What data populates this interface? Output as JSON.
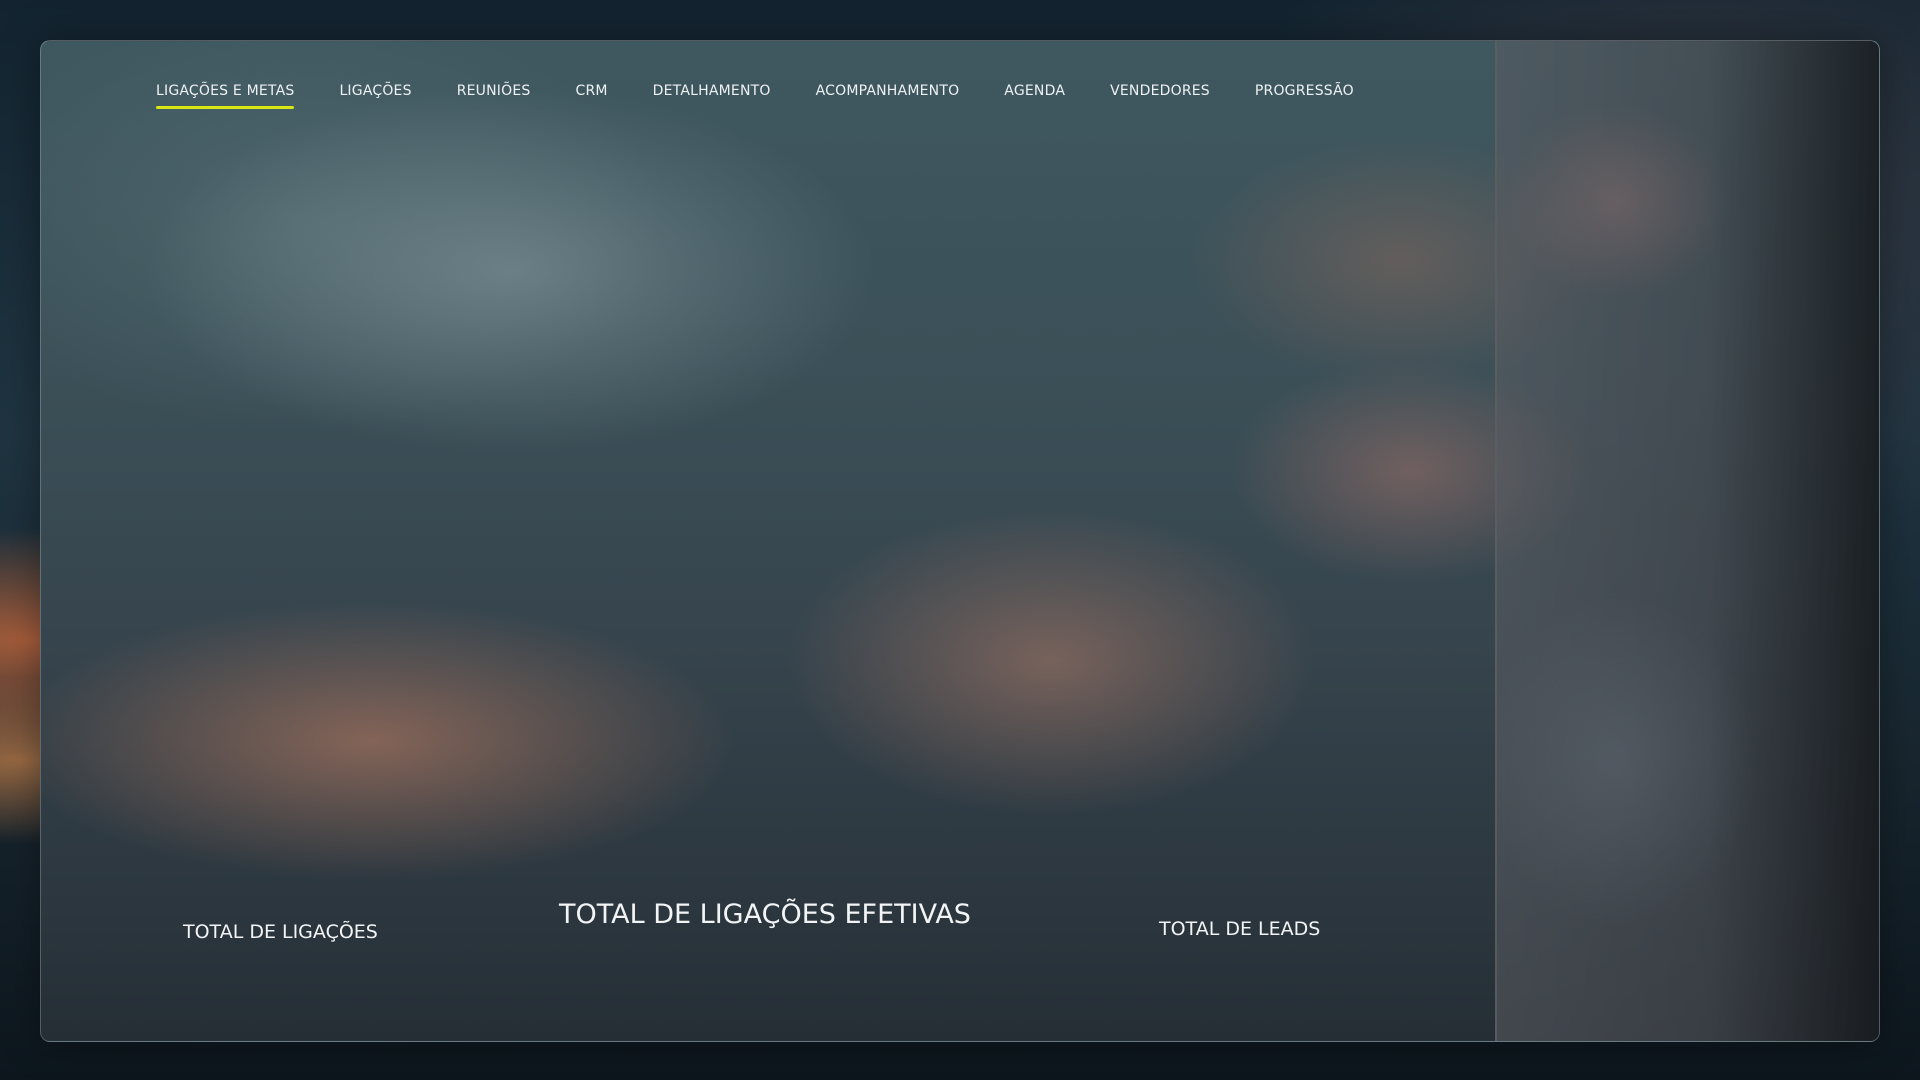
{
  "nav": {
    "items": [
      {
        "label": "LIGAÇÕES E METAS",
        "active": true
      },
      {
        "label": "LIGAÇÕES",
        "active": false
      },
      {
        "label": "REUNIÕES",
        "active": false
      },
      {
        "label": "CRM",
        "active": false
      },
      {
        "label": "DETALHAMENTO",
        "active": false
      },
      {
        "label": "ACOMPANHAMENTO",
        "active": false
      },
      {
        "label": "AGENDA",
        "active": false
      },
      {
        "label": "VENDEDORES",
        "active": false
      },
      {
        "label": "PROGRESSÃO",
        "active": false
      }
    ]
  },
  "stats": {
    "total_ligacoes_label": "TOTAL DE LIGAÇÕES",
    "total_efetivas_label": "TOTAL DE LIGAÇÕES EFETIVAS",
    "total_leads_label": "TOTAL DE LEADS"
  },
  "colors": {
    "accent": "#d8e614",
    "text": "#eef1f2"
  }
}
